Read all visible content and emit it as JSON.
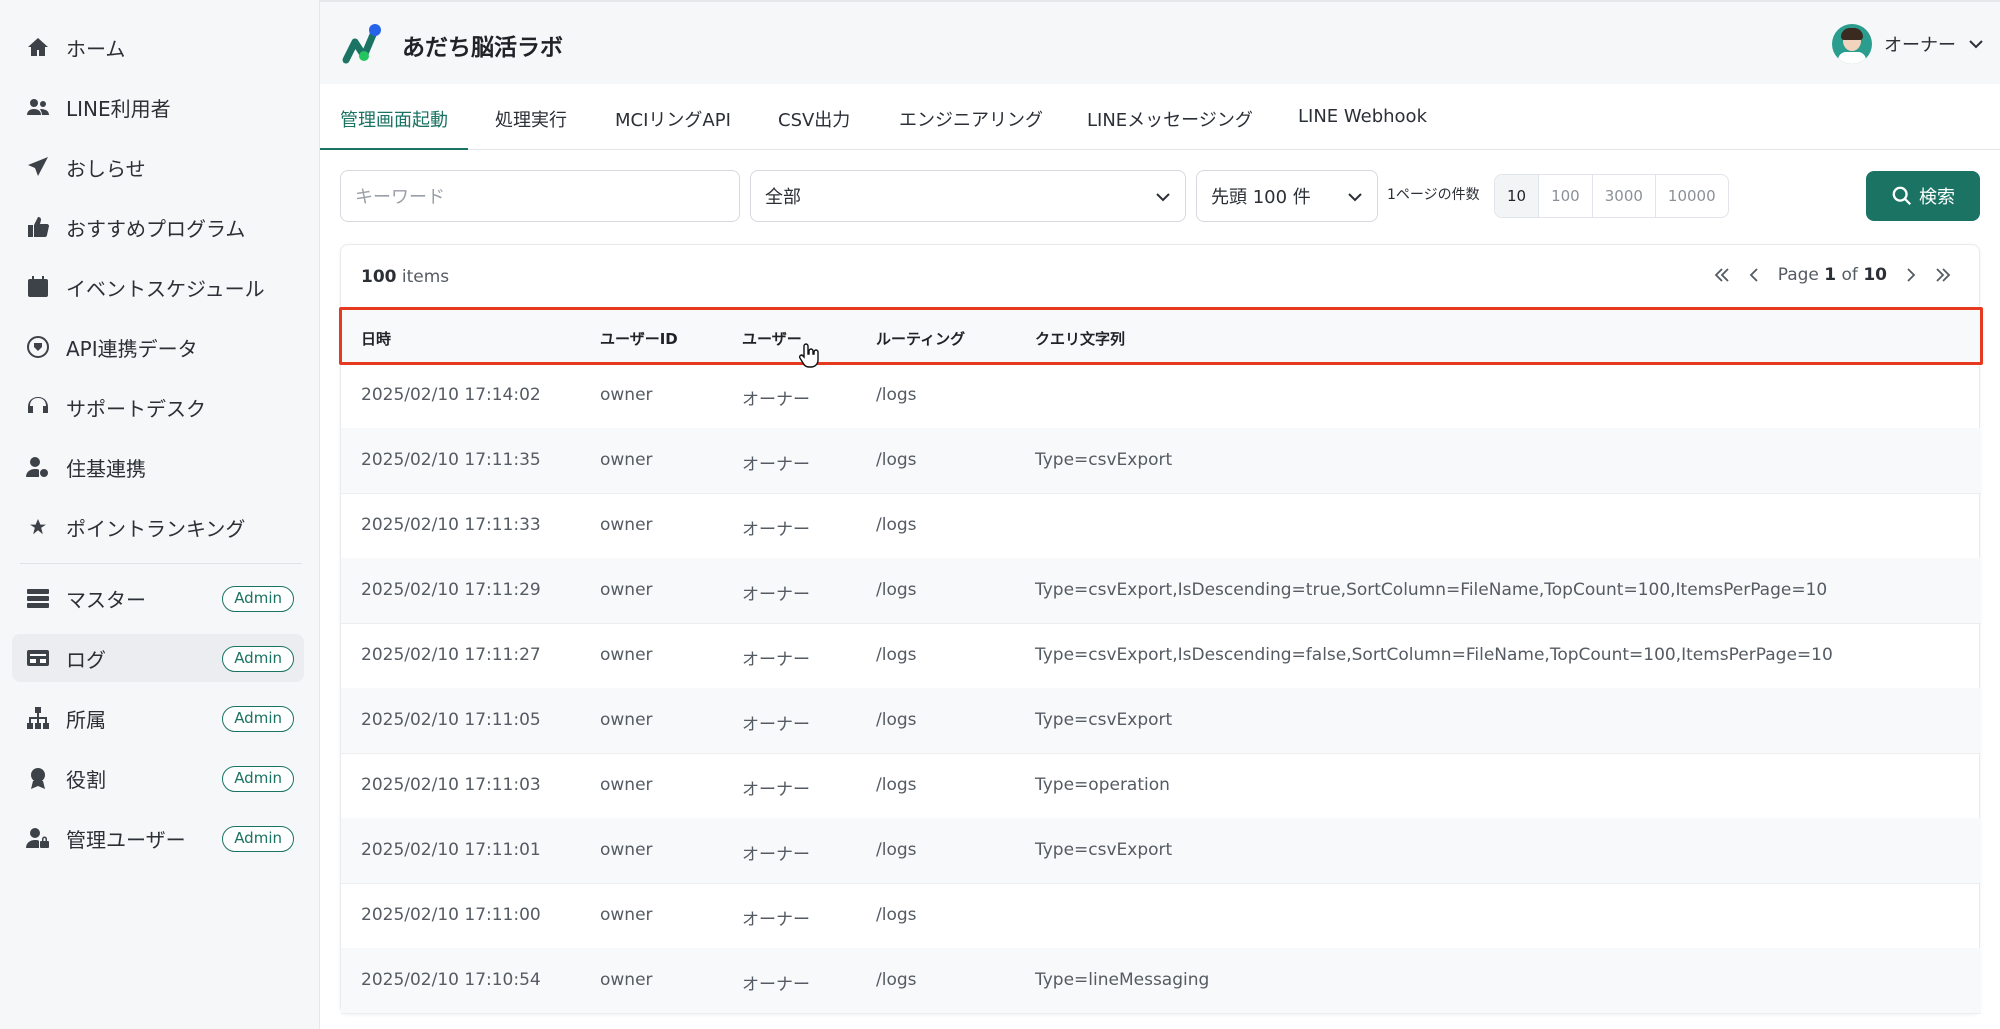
{
  "app": {
    "title": "あだち脳活ラボ"
  },
  "user": {
    "name": "オーナー"
  },
  "sidebar": {
    "items": [
      {
        "label": "ホーム",
        "icon": "home-icon"
      },
      {
        "label": "LINE利用者",
        "icon": "users-icon"
      },
      {
        "label": "おしらせ",
        "icon": "send-icon"
      },
      {
        "label": "おすすめプログラム",
        "icon": "thumbs-up-icon"
      },
      {
        "label": "イベントスケジュール",
        "icon": "calendar-icon"
      },
      {
        "label": "API連携データ",
        "icon": "plug-icon"
      },
      {
        "label": "サポートデスク",
        "icon": "headset-icon"
      },
      {
        "label": "住基連携",
        "icon": "user-gear-icon"
      },
      {
        "label": "ポイントランキング",
        "icon": "star-icon"
      },
      {
        "label": "マスター",
        "icon": "server-icon",
        "badge": "Admin"
      },
      {
        "label": "ログ",
        "icon": "log-icon",
        "badge": "Admin",
        "active": true
      },
      {
        "label": "所属",
        "icon": "sitemap-icon",
        "badge": "Admin"
      },
      {
        "label": "役割",
        "icon": "award-icon",
        "badge": "Admin"
      },
      {
        "label": "管理ユーザー",
        "icon": "user-lock-icon",
        "badge": "Admin"
      }
    ]
  },
  "tabs": [
    {
      "label": "管理画面起動",
      "active": true
    },
    {
      "label": "処理実行"
    },
    {
      "label": "MCIリングAPI"
    },
    {
      "label": "CSV出力"
    },
    {
      "label": "エンジニアリング"
    },
    {
      "label": "LINEメッセージング"
    },
    {
      "label": "LINE Webhook"
    }
  ],
  "filters": {
    "keyword_placeholder": "キーワード",
    "category_value": "全部",
    "top_value": "先頭 100 件",
    "per_page_label": "1ページの件数",
    "per_page_options": [
      "10",
      "100",
      "3000",
      "10000"
    ],
    "per_page_selected": "10",
    "search_label": "検索"
  },
  "table": {
    "count_num": "100",
    "count_suffix": " items",
    "page_prefix": "Page ",
    "page_current": "1",
    "page_of": " of ",
    "page_total": "10",
    "columns": [
      "日時",
      "ユーザーID",
      "ユーザー",
      "ルーティング",
      "クエリ文字列"
    ],
    "rows": [
      [
        "2025/02/10 17:14:02",
        "owner",
        "オーナー",
        "/logs",
        ""
      ],
      [
        "2025/02/10 17:11:35",
        "owner",
        "オーナー",
        "/logs",
        "Type=csvExport"
      ],
      [
        "2025/02/10 17:11:33",
        "owner",
        "オーナー",
        "/logs",
        ""
      ],
      [
        "2025/02/10 17:11:29",
        "owner",
        "オーナー",
        "/logs",
        "Type=csvExport,IsDescending=true,SortColumn=FileName,TopCount=100,ItemsPerPage=10"
      ],
      [
        "2025/02/10 17:11:27",
        "owner",
        "オーナー",
        "/logs",
        "Type=csvExport,IsDescending=false,SortColumn=FileName,TopCount=100,ItemsPerPage=10"
      ],
      [
        "2025/02/10 17:11:05",
        "owner",
        "オーナー",
        "/logs",
        "Type=csvExport"
      ],
      [
        "2025/02/10 17:11:03",
        "owner",
        "オーナー",
        "/logs",
        "Type=operation"
      ],
      [
        "2025/02/10 17:11:01",
        "owner",
        "オーナー",
        "/logs",
        "Type=csvExport"
      ],
      [
        "2025/02/10 17:11:00",
        "owner",
        "オーナー",
        "/logs",
        ""
      ],
      [
        "2025/02/10 17:10:54",
        "owner",
        "オーナー",
        "/logs",
        "Type=lineMessaging"
      ]
    ]
  },
  "colors": {
    "accent": "#1a7363",
    "highlight": "#e53a1f"
  }
}
